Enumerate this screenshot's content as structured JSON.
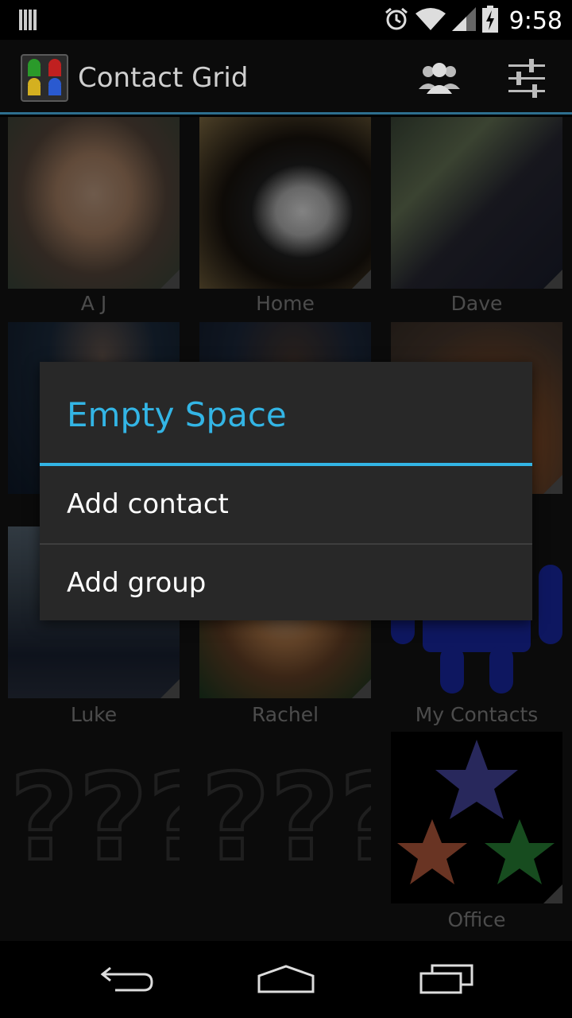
{
  "status_bar": {
    "time": "9:58",
    "icons": [
      "barcode-icon",
      "alarm-icon",
      "wifi-icon",
      "signal-icon",
      "battery-charging-icon"
    ]
  },
  "action_bar": {
    "app_title": "Contact Grid",
    "app_icon": "android-grid-icon",
    "actions": [
      "groups-icon",
      "settings-sliders-icon"
    ]
  },
  "grid": {
    "tiles": [
      {
        "caption": "A J",
        "kind": "photo-man"
      },
      {
        "caption": "Home",
        "kind": "photo-cat"
      },
      {
        "caption": "Dave",
        "kind": "photo-man-outdoor"
      },
      {
        "caption": "",
        "kind": "photo-bald-man"
      },
      {
        "caption": "",
        "kind": "photo-woman"
      },
      {
        "caption": "",
        "kind": "photo-orange"
      },
      {
        "caption": "Luke",
        "kind": "photo-man-suit"
      },
      {
        "caption": "Rachel",
        "kind": "photo-girl"
      },
      {
        "caption": "My Contacts",
        "kind": "android-blue-icon"
      },
      {
        "caption": "",
        "kind": "unknown-question-icon"
      },
      {
        "caption": "",
        "kind": "unknown-question-icon"
      },
      {
        "caption": "Office",
        "kind": "stars-icon"
      }
    ]
  },
  "dialog": {
    "title": "Empty Space",
    "items": [
      "Add contact",
      "Add group"
    ]
  },
  "nav_bar": {
    "buttons": [
      "back-icon",
      "home-icon",
      "recents-icon"
    ]
  },
  "colors": {
    "accent": "#33b5e5",
    "dialog_bg": "#282828",
    "action_bar_border": "#2e6f8f"
  }
}
